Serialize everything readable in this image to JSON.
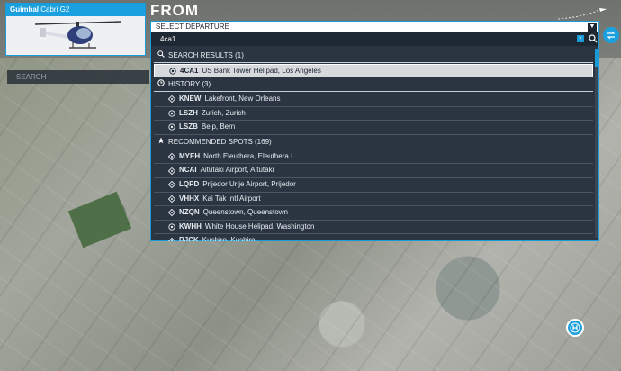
{
  "aircraft": {
    "manufacturer": "Guimbal",
    "model": "Cabri G2"
  },
  "header": {
    "title": "FROM"
  },
  "left_search": {
    "placeholder": "SEARCH"
  },
  "departure": {
    "label": "SELECT DEPARTURE",
    "search_value": "4ca1",
    "clear_label": "×",
    "sections": [
      {
        "icon": "search-icon",
        "title": "SEARCH RESULTS (1)",
        "items": [
          {
            "icon": "heliport-icon",
            "code": "4CA1",
            "name": "US Bank Tower Helipad, Los Angeles",
            "selected": true
          }
        ]
      },
      {
        "icon": "clock-icon",
        "title": "HISTORY (3)",
        "items": [
          {
            "icon": "airport-icon",
            "code": "KNEW",
            "name": "Lakefront, New Orleans"
          },
          {
            "icon": "heliport-icon",
            "code": "LSZH",
            "name": "Zurich, Zurich"
          },
          {
            "icon": "heliport-icon",
            "code": "LSZB",
            "name": "Belp, Bern"
          }
        ]
      },
      {
        "icon": "star-icon",
        "title": "RECOMMENDED SPOTS (169)",
        "items": [
          {
            "icon": "airport-icon",
            "code": "MYEH",
            "name": "North Eleuthera, Eleuthera I"
          },
          {
            "icon": "airport-icon",
            "code": "NCAI",
            "name": "Aitutaki Airport, Aitutaki"
          },
          {
            "icon": "airport-icon",
            "code": "LQPD",
            "name": "Prijedor Urije Airport, Prijedor"
          },
          {
            "icon": "airport-icon",
            "code": "VHHX",
            "name": "Kai Tak Intl Airport"
          },
          {
            "icon": "airport-icon",
            "code": "NZQN",
            "name": "Queenstown, Queenstown"
          },
          {
            "icon": "heliport-icon",
            "code": "KWHH",
            "name": "White House Helipad, Washington"
          },
          {
            "icon": "airport-icon",
            "code": "RJCK",
            "name": "Kushiro, Kushiro"
          }
        ]
      }
    ]
  },
  "colors": {
    "accent": "#1aa0df",
    "panel": "#2b3541",
    "selected": "#d7dadd"
  }
}
